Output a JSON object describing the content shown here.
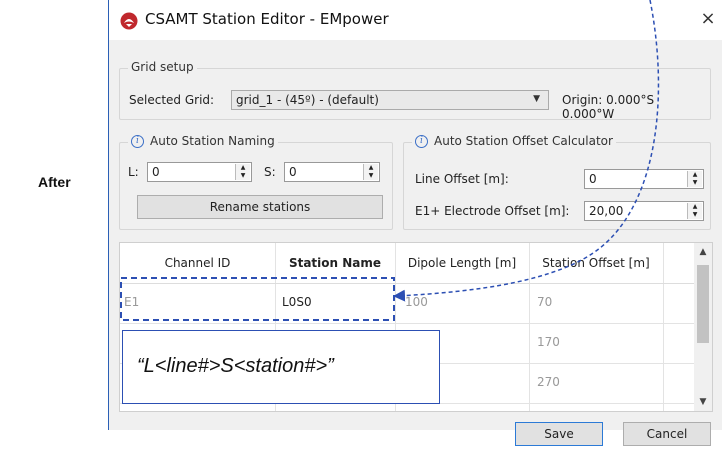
{
  "side_label": "After",
  "window": {
    "title": "CSAMT Station Editor - EMpower",
    "close_glyph": "×"
  },
  "grid_setup": {
    "title": "Grid setup",
    "selected_label": "Selected Grid:",
    "selected_value": "grid_1 - (45º) - (default)",
    "origin": "Origin: 0.000°S 0.000°W"
  },
  "auto_naming": {
    "title": "Auto Station Naming",
    "l_label": "L:",
    "l_value": "0",
    "s_label": "S:",
    "s_value": "0",
    "rename_button": "Rename stations"
  },
  "offset_calc": {
    "title": "Auto Station Offset Calculator",
    "line_offset_label": "Line Offset [m]:",
    "line_offset_value": "0",
    "e1_offset_label": "E1+ Electrode Offset [m]:",
    "e1_offset_value": "20,00"
  },
  "table": {
    "headers": [
      "Channel ID",
      "Station Name",
      "Dipole Length [m]",
      "Station Offset [m]"
    ],
    "rows": [
      {
        "channel": "E1",
        "station": "L0S0",
        "dipole": "100",
        "offset": "70"
      },
      {
        "channel": "",
        "station": "",
        "dipole": "",
        "offset": "170"
      },
      {
        "channel": "",
        "station": "",
        "dipole": "",
        "offset": "270"
      }
    ]
  },
  "callout": {
    "text": "“L<line#>S<station#>”"
  },
  "buttons": {
    "save": "Save",
    "cancel": "Cancel"
  },
  "colors": {
    "annotation_blue": "#2c4fb3",
    "accent": "#2c7ad6"
  },
  "icons": {
    "app": "empower-logo-icon",
    "info": "info-icon"
  }
}
